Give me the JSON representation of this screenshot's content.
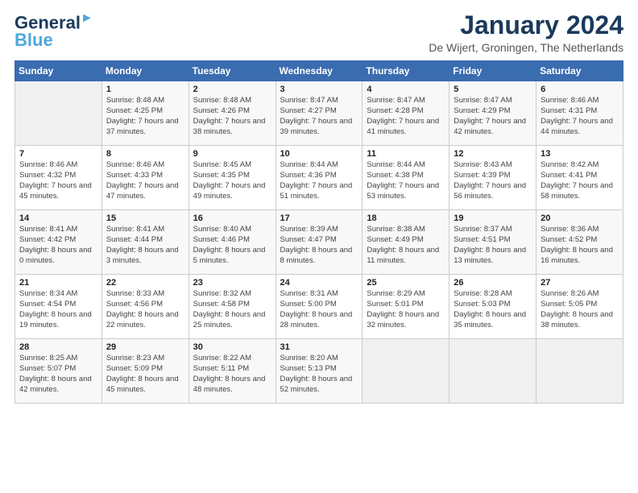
{
  "logo": {
    "line1": "General",
    "line2": "Blue"
  },
  "header": {
    "month": "January 2024",
    "location": "De Wijert, Groningen, The Netherlands"
  },
  "weekdays": [
    "Sunday",
    "Monday",
    "Tuesday",
    "Wednesday",
    "Thursday",
    "Friday",
    "Saturday"
  ],
  "weeks": [
    [
      {
        "num": "",
        "empty": true
      },
      {
        "num": "1",
        "sunrise": "Sunrise: 8:48 AM",
        "sunset": "Sunset: 4:25 PM",
        "daylight": "Daylight: 7 hours and 37 minutes."
      },
      {
        "num": "2",
        "sunrise": "Sunrise: 8:48 AM",
        "sunset": "Sunset: 4:26 PM",
        "daylight": "Daylight: 7 hours and 38 minutes."
      },
      {
        "num": "3",
        "sunrise": "Sunrise: 8:47 AM",
        "sunset": "Sunset: 4:27 PM",
        "daylight": "Daylight: 7 hours and 39 minutes."
      },
      {
        "num": "4",
        "sunrise": "Sunrise: 8:47 AM",
        "sunset": "Sunset: 4:28 PM",
        "daylight": "Daylight: 7 hours and 41 minutes."
      },
      {
        "num": "5",
        "sunrise": "Sunrise: 8:47 AM",
        "sunset": "Sunset: 4:29 PM",
        "daylight": "Daylight: 7 hours and 42 minutes."
      },
      {
        "num": "6",
        "sunrise": "Sunrise: 8:46 AM",
        "sunset": "Sunset: 4:31 PM",
        "daylight": "Daylight: 7 hours and 44 minutes."
      }
    ],
    [
      {
        "num": "7",
        "sunrise": "Sunrise: 8:46 AM",
        "sunset": "Sunset: 4:32 PM",
        "daylight": "Daylight: 7 hours and 45 minutes."
      },
      {
        "num": "8",
        "sunrise": "Sunrise: 8:46 AM",
        "sunset": "Sunset: 4:33 PM",
        "daylight": "Daylight: 7 hours and 47 minutes."
      },
      {
        "num": "9",
        "sunrise": "Sunrise: 8:45 AM",
        "sunset": "Sunset: 4:35 PM",
        "daylight": "Daylight: 7 hours and 49 minutes."
      },
      {
        "num": "10",
        "sunrise": "Sunrise: 8:44 AM",
        "sunset": "Sunset: 4:36 PM",
        "daylight": "Daylight: 7 hours and 51 minutes."
      },
      {
        "num": "11",
        "sunrise": "Sunrise: 8:44 AM",
        "sunset": "Sunset: 4:38 PM",
        "daylight": "Daylight: 7 hours and 53 minutes."
      },
      {
        "num": "12",
        "sunrise": "Sunrise: 8:43 AM",
        "sunset": "Sunset: 4:39 PM",
        "daylight": "Daylight: 7 hours and 56 minutes."
      },
      {
        "num": "13",
        "sunrise": "Sunrise: 8:42 AM",
        "sunset": "Sunset: 4:41 PM",
        "daylight": "Daylight: 7 hours and 58 minutes."
      }
    ],
    [
      {
        "num": "14",
        "sunrise": "Sunrise: 8:41 AM",
        "sunset": "Sunset: 4:42 PM",
        "daylight": "Daylight: 8 hours and 0 minutes."
      },
      {
        "num": "15",
        "sunrise": "Sunrise: 8:41 AM",
        "sunset": "Sunset: 4:44 PM",
        "daylight": "Daylight: 8 hours and 3 minutes."
      },
      {
        "num": "16",
        "sunrise": "Sunrise: 8:40 AM",
        "sunset": "Sunset: 4:46 PM",
        "daylight": "Daylight: 8 hours and 5 minutes."
      },
      {
        "num": "17",
        "sunrise": "Sunrise: 8:39 AM",
        "sunset": "Sunset: 4:47 PM",
        "daylight": "Daylight: 8 hours and 8 minutes."
      },
      {
        "num": "18",
        "sunrise": "Sunrise: 8:38 AM",
        "sunset": "Sunset: 4:49 PM",
        "daylight": "Daylight: 8 hours and 11 minutes."
      },
      {
        "num": "19",
        "sunrise": "Sunrise: 8:37 AM",
        "sunset": "Sunset: 4:51 PM",
        "daylight": "Daylight: 8 hours and 13 minutes."
      },
      {
        "num": "20",
        "sunrise": "Sunrise: 8:36 AM",
        "sunset": "Sunset: 4:52 PM",
        "daylight": "Daylight: 8 hours and 16 minutes."
      }
    ],
    [
      {
        "num": "21",
        "sunrise": "Sunrise: 8:34 AM",
        "sunset": "Sunset: 4:54 PM",
        "daylight": "Daylight: 8 hours and 19 minutes."
      },
      {
        "num": "22",
        "sunrise": "Sunrise: 8:33 AM",
        "sunset": "Sunset: 4:56 PM",
        "daylight": "Daylight: 8 hours and 22 minutes."
      },
      {
        "num": "23",
        "sunrise": "Sunrise: 8:32 AM",
        "sunset": "Sunset: 4:58 PM",
        "daylight": "Daylight: 8 hours and 25 minutes."
      },
      {
        "num": "24",
        "sunrise": "Sunrise: 8:31 AM",
        "sunset": "Sunset: 5:00 PM",
        "daylight": "Daylight: 8 hours and 28 minutes."
      },
      {
        "num": "25",
        "sunrise": "Sunrise: 8:29 AM",
        "sunset": "Sunset: 5:01 PM",
        "daylight": "Daylight: 8 hours and 32 minutes."
      },
      {
        "num": "26",
        "sunrise": "Sunrise: 8:28 AM",
        "sunset": "Sunset: 5:03 PM",
        "daylight": "Daylight: 8 hours and 35 minutes."
      },
      {
        "num": "27",
        "sunrise": "Sunrise: 8:26 AM",
        "sunset": "Sunset: 5:05 PM",
        "daylight": "Daylight: 8 hours and 38 minutes."
      }
    ],
    [
      {
        "num": "28",
        "sunrise": "Sunrise: 8:25 AM",
        "sunset": "Sunset: 5:07 PM",
        "daylight": "Daylight: 8 hours and 42 minutes."
      },
      {
        "num": "29",
        "sunrise": "Sunrise: 8:23 AM",
        "sunset": "Sunset: 5:09 PM",
        "daylight": "Daylight: 8 hours and 45 minutes."
      },
      {
        "num": "30",
        "sunrise": "Sunrise: 8:22 AM",
        "sunset": "Sunset: 5:11 PM",
        "daylight": "Daylight: 8 hours and 48 minutes."
      },
      {
        "num": "31",
        "sunrise": "Sunrise: 8:20 AM",
        "sunset": "Sunset: 5:13 PM",
        "daylight": "Daylight: 8 hours and 52 minutes."
      },
      {
        "num": "",
        "empty": true
      },
      {
        "num": "",
        "empty": true
      },
      {
        "num": "",
        "empty": true
      }
    ]
  ]
}
